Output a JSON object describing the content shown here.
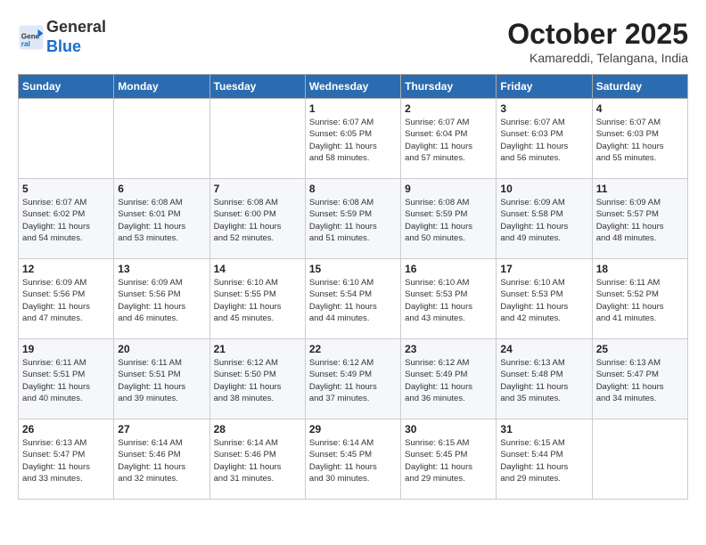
{
  "header": {
    "logo_line1": "General",
    "logo_line2": "Blue",
    "month_title": "October 2025",
    "location": "Kamareddi, Telangana, India"
  },
  "weekdays": [
    "Sunday",
    "Monday",
    "Tuesday",
    "Wednesday",
    "Thursday",
    "Friday",
    "Saturday"
  ],
  "weeks": [
    [
      {
        "day": "",
        "info": ""
      },
      {
        "day": "",
        "info": ""
      },
      {
        "day": "",
        "info": ""
      },
      {
        "day": "1",
        "info": "Sunrise: 6:07 AM\nSunset: 6:05 PM\nDaylight: 11 hours\nand 58 minutes."
      },
      {
        "day": "2",
        "info": "Sunrise: 6:07 AM\nSunset: 6:04 PM\nDaylight: 11 hours\nand 57 minutes."
      },
      {
        "day": "3",
        "info": "Sunrise: 6:07 AM\nSunset: 6:03 PM\nDaylight: 11 hours\nand 56 minutes."
      },
      {
        "day": "4",
        "info": "Sunrise: 6:07 AM\nSunset: 6:03 PM\nDaylight: 11 hours\nand 55 minutes."
      }
    ],
    [
      {
        "day": "5",
        "info": "Sunrise: 6:07 AM\nSunset: 6:02 PM\nDaylight: 11 hours\nand 54 minutes."
      },
      {
        "day": "6",
        "info": "Sunrise: 6:08 AM\nSunset: 6:01 PM\nDaylight: 11 hours\nand 53 minutes."
      },
      {
        "day": "7",
        "info": "Sunrise: 6:08 AM\nSunset: 6:00 PM\nDaylight: 11 hours\nand 52 minutes."
      },
      {
        "day": "8",
        "info": "Sunrise: 6:08 AM\nSunset: 5:59 PM\nDaylight: 11 hours\nand 51 minutes."
      },
      {
        "day": "9",
        "info": "Sunrise: 6:08 AM\nSunset: 5:59 PM\nDaylight: 11 hours\nand 50 minutes."
      },
      {
        "day": "10",
        "info": "Sunrise: 6:09 AM\nSunset: 5:58 PM\nDaylight: 11 hours\nand 49 minutes."
      },
      {
        "day": "11",
        "info": "Sunrise: 6:09 AM\nSunset: 5:57 PM\nDaylight: 11 hours\nand 48 minutes."
      }
    ],
    [
      {
        "day": "12",
        "info": "Sunrise: 6:09 AM\nSunset: 5:56 PM\nDaylight: 11 hours\nand 47 minutes."
      },
      {
        "day": "13",
        "info": "Sunrise: 6:09 AM\nSunset: 5:56 PM\nDaylight: 11 hours\nand 46 minutes."
      },
      {
        "day": "14",
        "info": "Sunrise: 6:10 AM\nSunset: 5:55 PM\nDaylight: 11 hours\nand 45 minutes."
      },
      {
        "day": "15",
        "info": "Sunrise: 6:10 AM\nSunset: 5:54 PM\nDaylight: 11 hours\nand 44 minutes."
      },
      {
        "day": "16",
        "info": "Sunrise: 6:10 AM\nSunset: 5:53 PM\nDaylight: 11 hours\nand 43 minutes."
      },
      {
        "day": "17",
        "info": "Sunrise: 6:10 AM\nSunset: 5:53 PM\nDaylight: 11 hours\nand 42 minutes."
      },
      {
        "day": "18",
        "info": "Sunrise: 6:11 AM\nSunset: 5:52 PM\nDaylight: 11 hours\nand 41 minutes."
      }
    ],
    [
      {
        "day": "19",
        "info": "Sunrise: 6:11 AM\nSunset: 5:51 PM\nDaylight: 11 hours\nand 40 minutes."
      },
      {
        "day": "20",
        "info": "Sunrise: 6:11 AM\nSunset: 5:51 PM\nDaylight: 11 hours\nand 39 minutes."
      },
      {
        "day": "21",
        "info": "Sunrise: 6:12 AM\nSunset: 5:50 PM\nDaylight: 11 hours\nand 38 minutes."
      },
      {
        "day": "22",
        "info": "Sunrise: 6:12 AM\nSunset: 5:49 PM\nDaylight: 11 hours\nand 37 minutes."
      },
      {
        "day": "23",
        "info": "Sunrise: 6:12 AM\nSunset: 5:49 PM\nDaylight: 11 hours\nand 36 minutes."
      },
      {
        "day": "24",
        "info": "Sunrise: 6:13 AM\nSunset: 5:48 PM\nDaylight: 11 hours\nand 35 minutes."
      },
      {
        "day": "25",
        "info": "Sunrise: 6:13 AM\nSunset: 5:47 PM\nDaylight: 11 hours\nand 34 minutes."
      }
    ],
    [
      {
        "day": "26",
        "info": "Sunrise: 6:13 AM\nSunset: 5:47 PM\nDaylight: 11 hours\nand 33 minutes."
      },
      {
        "day": "27",
        "info": "Sunrise: 6:14 AM\nSunset: 5:46 PM\nDaylight: 11 hours\nand 32 minutes."
      },
      {
        "day": "28",
        "info": "Sunrise: 6:14 AM\nSunset: 5:46 PM\nDaylight: 11 hours\nand 31 minutes."
      },
      {
        "day": "29",
        "info": "Sunrise: 6:14 AM\nSunset: 5:45 PM\nDaylight: 11 hours\nand 30 minutes."
      },
      {
        "day": "30",
        "info": "Sunrise: 6:15 AM\nSunset: 5:45 PM\nDaylight: 11 hours\nand 29 minutes."
      },
      {
        "day": "31",
        "info": "Sunrise: 6:15 AM\nSunset: 5:44 PM\nDaylight: 11 hours\nand 29 minutes."
      },
      {
        "day": "",
        "info": ""
      }
    ]
  ]
}
